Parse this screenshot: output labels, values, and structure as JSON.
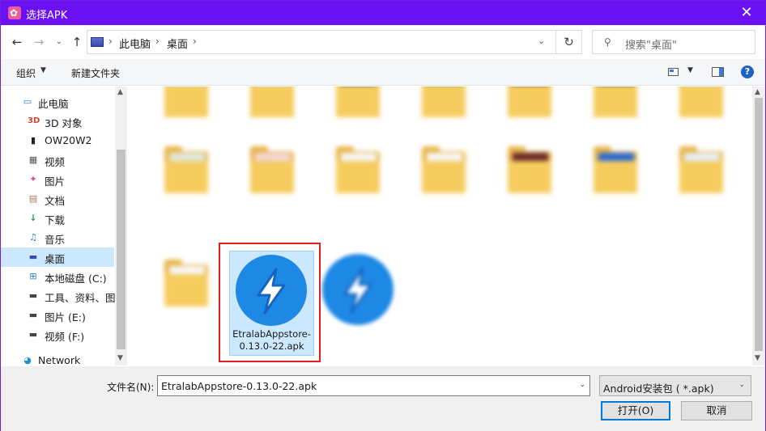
{
  "window": {
    "title": "选择APK",
    "close_glyph": "✕",
    "title_bar_color": "#6a10f2"
  },
  "nav": {
    "back_glyph": "←",
    "forward_glyph": "→",
    "recent_glyph": "⌄",
    "up_glyph": "↑",
    "breadcrumb": [
      "此电脑",
      "桌面"
    ],
    "separator": "›",
    "dropdown_glyph": "⌄",
    "refresh_glyph": "↻",
    "search_icon_glyph": "⚲",
    "search_placeholder": "搜索\"桌面\""
  },
  "toolbar": {
    "organize_label": "组织",
    "dropdown_glyph": "▼",
    "new_folder_label": "新建文件夹",
    "help_label": "?"
  },
  "sidebar": {
    "items": [
      {
        "label": "此电脑",
        "icon": "monitor-icon"
      },
      {
        "label": "3D 对象",
        "icon": "3d-objects-icon",
        "icon_text": "3D"
      },
      {
        "label": "OW20W2",
        "icon": "phone-icon"
      },
      {
        "label": "视频",
        "icon": "video-icon"
      },
      {
        "label": "图片",
        "icon": "pictures-icon"
      },
      {
        "label": "文档",
        "icon": "document-icon"
      },
      {
        "label": "下载",
        "icon": "download-icon"
      },
      {
        "label": "音乐",
        "icon": "music-icon"
      },
      {
        "label": "桌面",
        "icon": "desktop-icon",
        "selected": true
      },
      {
        "label": "本地磁盘 (C:)",
        "icon": "drive-c-icon"
      },
      {
        "label": "工具、资料、图",
        "icon": "drive-icon"
      },
      {
        "label": "图片 (E:)",
        "icon": "drive-e-icon"
      },
      {
        "label": "视频 (F:)",
        "icon": "drive-f-icon"
      },
      {
        "label": "Network",
        "icon": "network-icon"
      }
    ],
    "scroll_up_glyph": "▲",
    "scroll_down_glyph": "▼"
  },
  "files": {
    "selected_file_name": "EtralabAppstore-0.13.0-22.apk",
    "scroll_up_glyph": "▲",
    "scroll_down_glyph": "▼"
  },
  "bottom": {
    "filename_label": "文件名(N):",
    "filename_value": "EtralabAppstore-0.13.0-22.apk",
    "filetype_value": "Android安装包 ( *.apk)",
    "dropdown_glyph": "⌄",
    "open_label": "打开(O)",
    "cancel_label": "取消"
  }
}
